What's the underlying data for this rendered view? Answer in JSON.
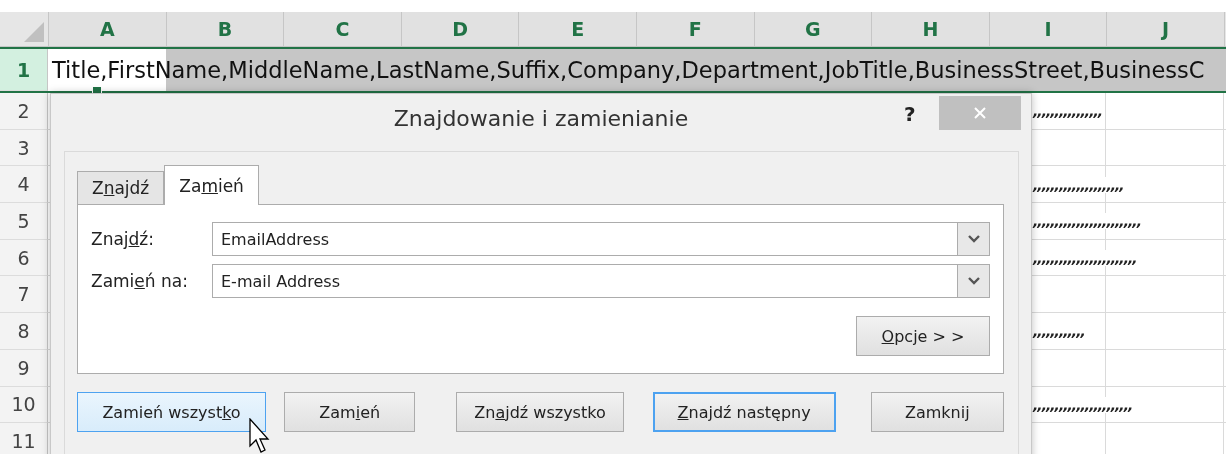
{
  "spreadsheet": {
    "columns": [
      {
        "label": "A",
        "selected": true
      },
      {
        "label": "B",
        "selected": true
      },
      {
        "label": "C",
        "selected": true
      },
      {
        "label": "D",
        "selected": true
      },
      {
        "label": "E",
        "selected": true
      },
      {
        "label": "F",
        "selected": true
      },
      {
        "label": "G",
        "selected": true
      },
      {
        "label": "H",
        "selected": true
      },
      {
        "label": "I",
        "selected": true
      },
      {
        "label": "J",
        "selected": true
      }
    ],
    "rows": [
      {
        "label": "1",
        "selected": true,
        "text": "Title,FirstName,MiddleName,LastName,Suffix,Company,Department,JobTitle,BusinessStreet,BusinessC"
      },
      {
        "label": "2",
        "selected": false,
        "text": ",,,,,,,,,,,,,,,,"
      },
      {
        "label": "3",
        "selected": false
      },
      {
        "label": "4",
        "selected": false,
        "text": ",,,,,,,,,,,,,,,,,,,,,"
      },
      {
        "label": "5",
        "selected": false,
        "text": ",,,,,,,,,,,,,,,,,,,,,,,,,"
      },
      {
        "label": "6",
        "selected": false,
        "text": ",,,,,,,,,,,,,,,,,,,,,,,,"
      },
      {
        "label": "7",
        "selected": false
      },
      {
        "label": "8",
        "selected": false,
        "text": ",,,,,,,,,,,,"
      },
      {
        "label": "9",
        "selected": false
      },
      {
        "label": "10",
        "selected": false,
        "text": ",,,,,,,,,,,,,,,,,,,,,,,"
      },
      {
        "label": "11",
        "selected": false
      }
    ]
  },
  "dialog": {
    "title": "Znajdowanie i zamienianie",
    "help": "?",
    "tabs": [
      {
        "label": {
          "before": "Z",
          "key": "n",
          "after": "ajdź"
        },
        "selected": false
      },
      {
        "label": {
          "before": "Za",
          "key": "m",
          "after": "ień"
        },
        "selected": true
      }
    ],
    "fields": [
      {
        "label": {
          "before": "Znaj",
          "key": "d",
          "after": "ź:"
        },
        "value": "EmailAddress"
      },
      {
        "label": {
          "before": "Zami",
          "key": "e",
          "after": "ń na:"
        },
        "value": "E-mail Address"
      }
    ],
    "options_button": {
      "label": {
        "key": "O",
        "after": "pcje > >"
      }
    },
    "buttons": [
      {
        "label": {
          "before": "Zamień wszyst",
          "key": "k",
          "after": "o"
        },
        "hovered": true,
        "focused": false
      },
      {
        "label": {
          "before": "Zam",
          "key": "i",
          "after": "eń"
        },
        "hovered": false,
        "focused": false
      },
      {
        "label": {
          "before": "Zn",
          "key": "a",
          "after": "jdź wszystko"
        },
        "hovered": false,
        "focused": false
      },
      {
        "label": {
          "key": "Z",
          "after": "najdź następny"
        },
        "hovered": false,
        "focused": true
      },
      {
        "label": {
          "before": "Zamknij"
        },
        "hovered": false,
        "focused": false
      }
    ]
  }
}
